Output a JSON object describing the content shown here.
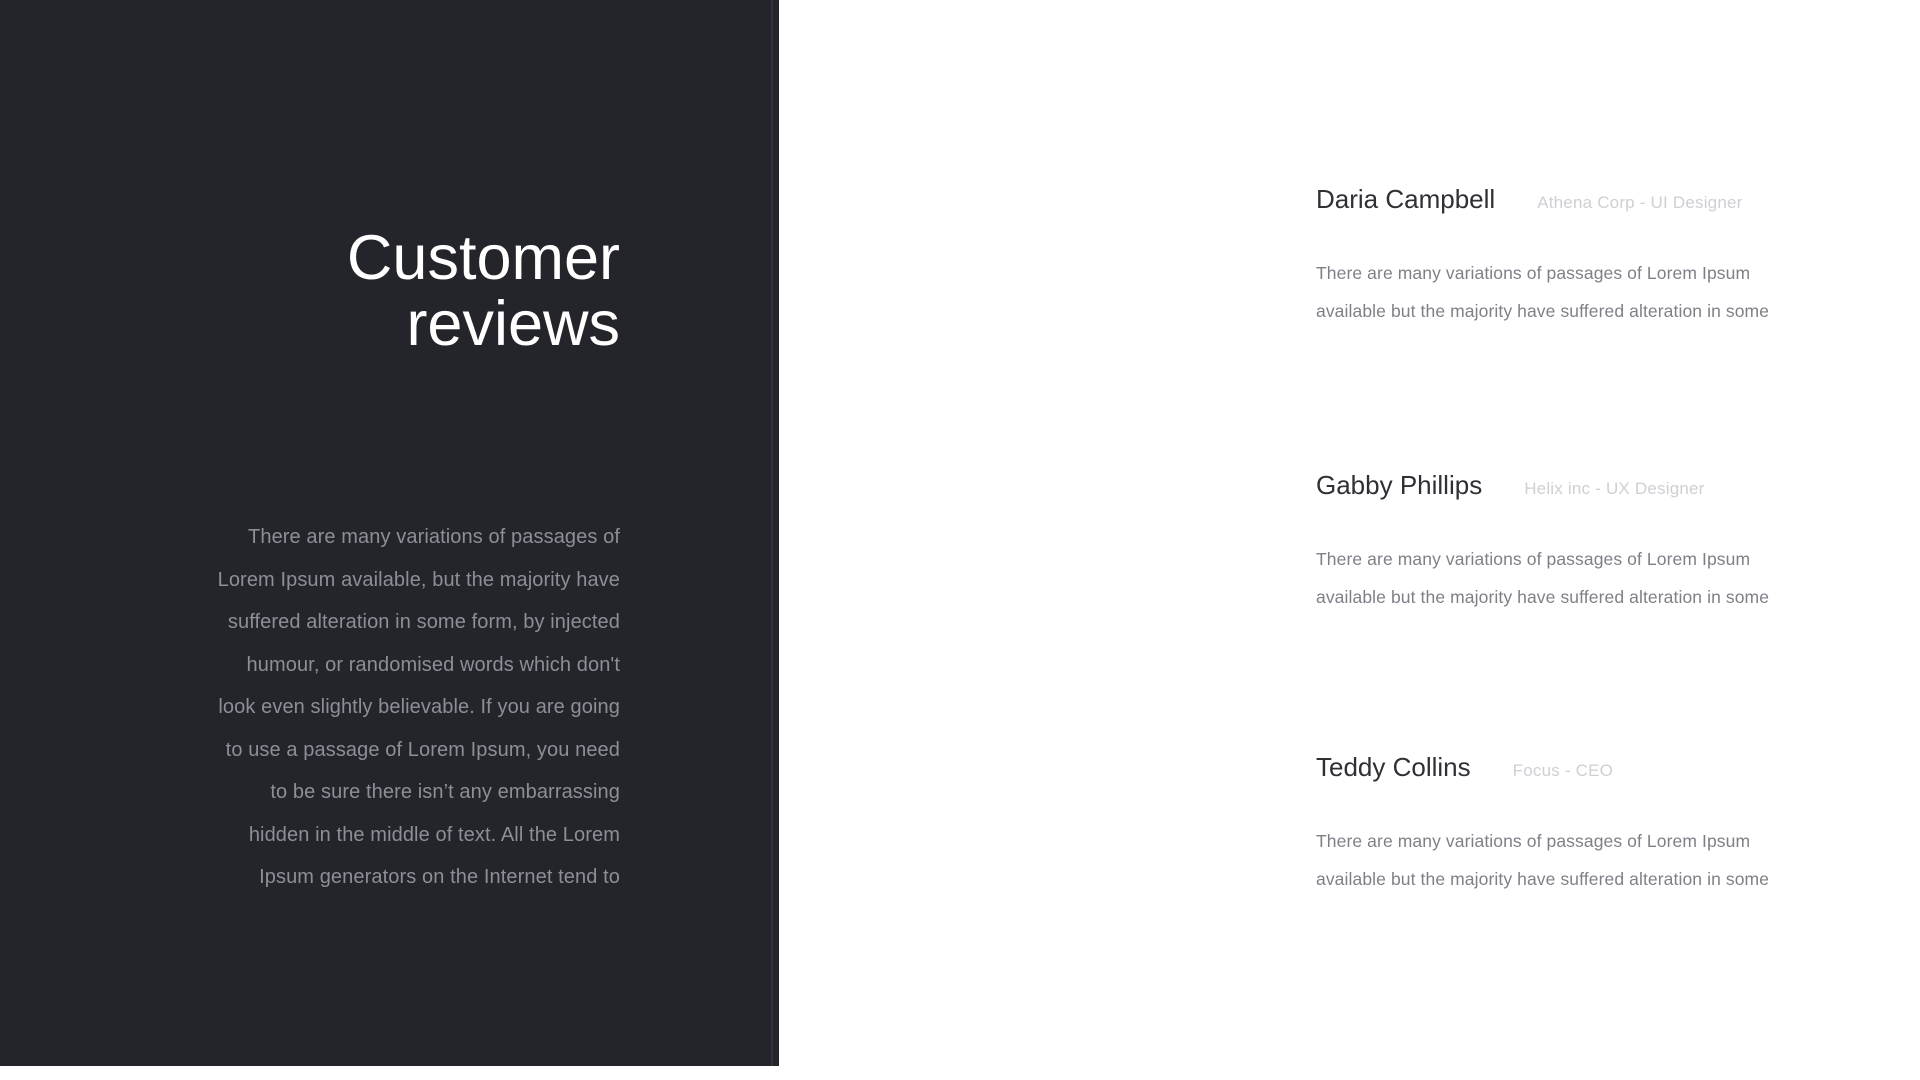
{
  "theme": {
    "panel_bg": "#24242b",
    "page_bg": "#ffffff",
    "title_color": "#ffffff",
    "muted_text": "#8e8e97",
    "name_color": "#2f2f36",
    "role_color": "#cfcfd4",
    "body_color": "#7f7f88"
  },
  "left_panel": {
    "title_line_1": "Customer",
    "title_line_2": "reviews",
    "paragraph_lines": [
      "There are many variations of passages of",
      "Lorem Ipsum available, but the majority have",
      "suffered alteration in some form, by injected",
      "humour, or randomised words which don't",
      "look even slightly believable. If you are going",
      "to use a passage of Lorem Ipsum, you need",
      "to be sure there isn’t any embarrassing",
      "hidden in the middle of text. All the Lorem",
      "Ipsum generators on the Internet tend to"
    ]
  },
  "reviews": [
    {
      "name": "Daria Campbell",
      "role": "Athena Corp - UI Designer",
      "body_line_1": "There are many variations of passages of Lorem Ipsum",
      "body_line_2": "available but the majority have suffered alteration in some"
    },
    {
      "name": "Gabby Phillips",
      "role": "Helix inc - UX Designer",
      "body_line_1": "There are many variations of passages of Lorem Ipsum",
      "body_line_2": "available but the majority have suffered alteration in some"
    },
    {
      "name": "Teddy Collins",
      "role": "Focus - CEO",
      "body_line_1": "There are many variations of passages of Lorem Ipsum",
      "body_line_2": "available but the majority have suffered alteration in some"
    }
  ]
}
